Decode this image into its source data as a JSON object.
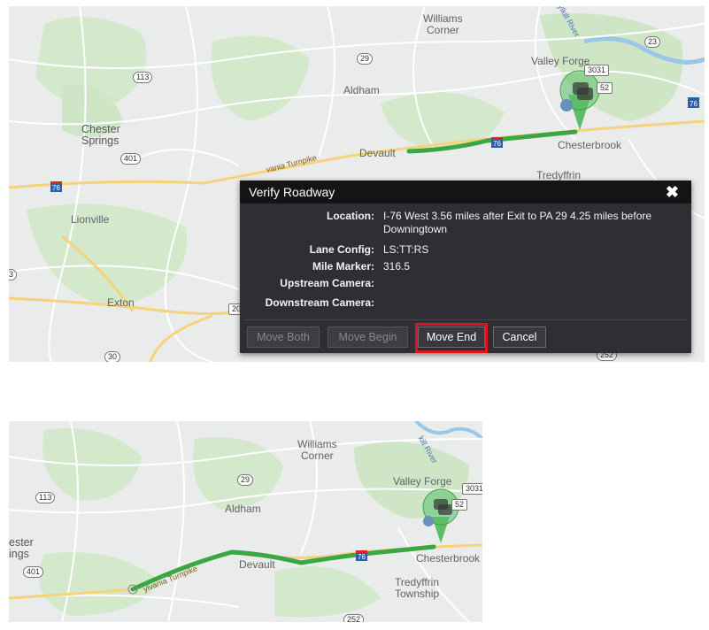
{
  "top_map": {
    "places": {
      "williams_corner": "Williams\nCorner",
      "valley_forge": "Valley Forge",
      "aldham": "Aldham",
      "chester_springs": "Chester\nSprings",
      "devault": "Devault",
      "chesterbrook": "Chesterbrook",
      "tredyffrin": "Tredyffrin",
      "lionville": "Lionville",
      "exton": "Exton",
      "turnpike": "vania Turnpike",
      "schuylkill": "ylkill River"
    },
    "shields": {
      "r23": "23",
      "r29": "29",
      "r113": "113",
      "r3031": "3031",
      "r401": "401",
      "i76_left": "76",
      "i76_mid": "76",
      "i76_right": "76",
      "r252": "252",
      "r30": "30",
      "r202": "20",
      "r3": "3",
      "r52": "52"
    }
  },
  "dialog": {
    "title": "Verify Roadway",
    "fields": {
      "location_label": "Location:",
      "location_value": "I-76 West 3.56 miles after Exit to PA 29 4.25 miles before Downingtown",
      "lane_label": "Lane Config:",
      "lane_value": "LS:TT:RS",
      "mile_label": "Mile Marker:",
      "mile_value": "316.5",
      "upstream_label": "Upstream Camera:",
      "upstream_value": "",
      "downstream_label": "Downstream Camera:",
      "downstream_value": ""
    },
    "buttons": {
      "move_both": "Move Both",
      "move_begin": "Move Begin",
      "move_end": "Move End",
      "cancel": "Cancel"
    },
    "highlight_color": "#e0141c"
  },
  "bottom_map": {
    "places": {
      "williams_corner": "Williams\nCorner",
      "valley_forge": "Valley Forge",
      "aldham": "Aldham",
      "springs": "ester\nings",
      "devault": "Devault",
      "chesterbrook": "Chesterbrook",
      "tredyffrin_township": "Tredyffrin\nTownship",
      "turnpike": "ylvania Turnpike",
      "schuylkill": "kill River"
    },
    "shields": {
      "r29": "29",
      "r113": "113",
      "r3031": "3031",
      "r401": "401",
      "i76": "76",
      "r252": "252",
      "r52": "52"
    }
  },
  "colors": {
    "route": "#3aa644",
    "map_bg": "#e9ecea",
    "park": "#cfe6c6",
    "road_major": "#f6d37a",
    "dialog_bg": "#2f2f33",
    "dialog_header": "#141414"
  }
}
